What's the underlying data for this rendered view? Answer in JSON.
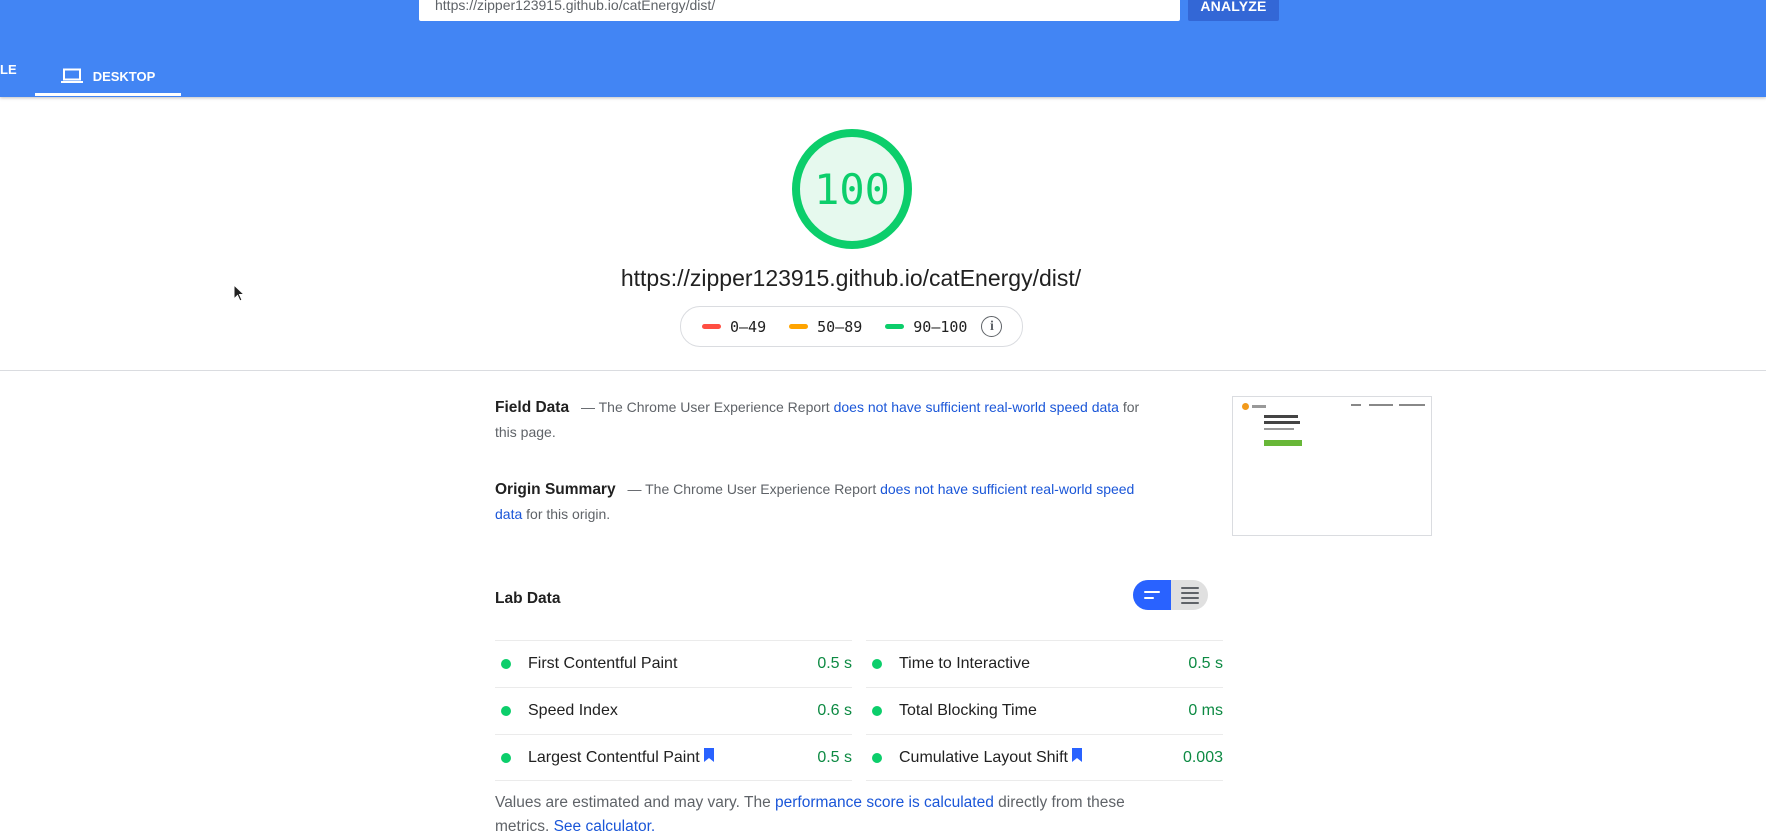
{
  "header": {
    "url_value": "https://zipper123915.github.io/catEnergy/dist/",
    "analyze_label": "ANALYZE",
    "tabs": [
      {
        "label": "LE",
        "icon": "phone-icon"
      },
      {
        "label": "DESKTOP",
        "icon": "laptop-icon",
        "active": true
      }
    ]
  },
  "score": {
    "value": "100",
    "score_fraction": 1.0,
    "report_url": "https://zipper123915.github.io/catEnergy/dist/",
    "legend": [
      {
        "label": "0–49",
        "color": "#ff4e42"
      },
      {
        "label": "50–89",
        "color": "#ffa400"
      },
      {
        "label": "90–100",
        "color": "#0cce6b"
      }
    ],
    "info_icon": "info-icon"
  },
  "field_data": {
    "label": "Field Data",
    "text_before": "— The Chrome User Experience Report",
    "link": "does not have sufficient real-world speed data",
    "text_after": "for this page."
  },
  "origin_summary": {
    "label": "Origin Summary",
    "text_before": "— The Chrome User Experience Report",
    "link": "does not have sufficient real-world speed data",
    "text_after": "for this origin."
  },
  "lab_data": {
    "title": "Lab Data",
    "left": [
      {
        "name": "First Contentful Paint",
        "value": "0.5 s",
        "flag": false
      },
      {
        "name": "Speed Index",
        "value": "0.6 s",
        "flag": false
      },
      {
        "name": "Largest Contentful Paint",
        "value": "0.5 s",
        "flag": true
      }
    ],
    "right": [
      {
        "name": "Time to Interactive",
        "value": "0.5 s",
        "flag": false
      },
      {
        "name": "Total Blocking Time",
        "value": "0 ms",
        "flag": false
      },
      {
        "name": "Cumulative Layout Shift",
        "value": "0.003",
        "flag": true
      }
    ]
  },
  "footnote": {
    "before": "Values are estimated and may vary. The",
    "link1": "performance score is calculated",
    "middle": "directly from these metrics.",
    "link2": "See calculator."
  },
  "colors": {
    "header_blue": "#4285f4",
    "pass_green": "#0cce6b",
    "link_blue": "#1a56d8"
  }
}
